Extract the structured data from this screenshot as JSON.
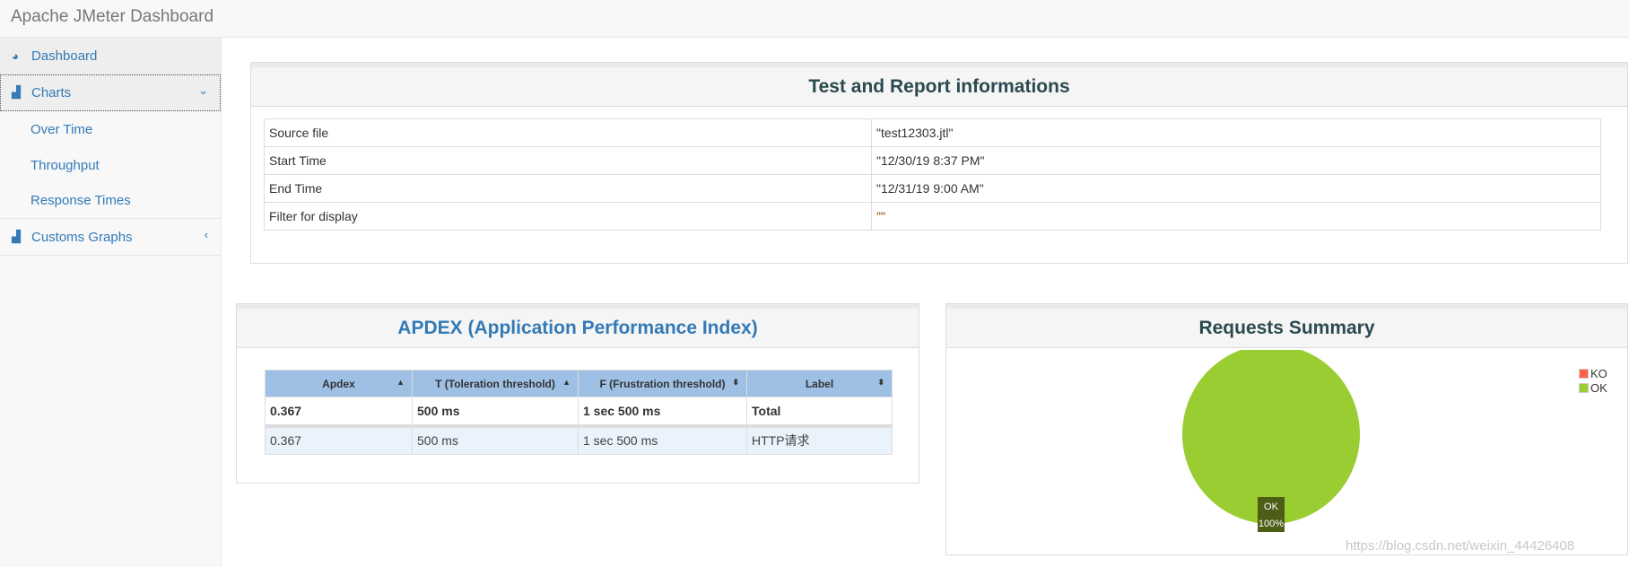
{
  "app_title": "Apache JMeter Dashboard",
  "sidebar": {
    "items": [
      {
        "label": "Dashboard",
        "icon": "dashboard-icon"
      },
      {
        "label": "Charts",
        "icon": "bar-chart-icon",
        "chevron": "chevron-down-icon"
      },
      {
        "label": "Over Time"
      },
      {
        "label": "Throughput"
      },
      {
        "label": "Response Times"
      },
      {
        "label": "Customs Graphs",
        "icon": "bar-chart-icon",
        "chevron": "chevron-left-icon"
      }
    ]
  },
  "info": {
    "title": "Test and Report informations",
    "rows": [
      {
        "k": "Source file",
        "v": "\"test12303.jtl\""
      },
      {
        "k": "Start Time",
        "v": "\"12/30/19 8:37 PM\""
      },
      {
        "k": "End Time",
        "v": "\"12/31/19 9:00 AM\""
      },
      {
        "k": "Filter for display",
        "v": "\"\""
      }
    ]
  },
  "apdex": {
    "title": "APDEX (Application Performance Index)",
    "headers": [
      "Apdex",
      "T (Toleration threshold)",
      "F (Frustration threshold)",
      "Label"
    ],
    "rows": [
      [
        "0.367",
        "500 ms",
        "1 sec 500 ms",
        "Total"
      ],
      [
        "0.367",
        "500 ms",
        "1 sec 500 ms",
        "HTTP请求"
      ]
    ]
  },
  "summary": {
    "title": "Requests Summary"
  },
  "chart_data": {
    "type": "pie",
    "title": "Requests Summary",
    "categories": [
      "KO",
      "OK"
    ],
    "values": [
      0,
      100
    ],
    "colors": [
      "#FF6347",
      "#9ACD32"
    ],
    "labels": [
      {
        "name": "OK",
        "pct": "100%"
      }
    ],
    "legend": "top-right"
  },
  "watermark": "https://blog.csdn.net/weixin_44426408"
}
